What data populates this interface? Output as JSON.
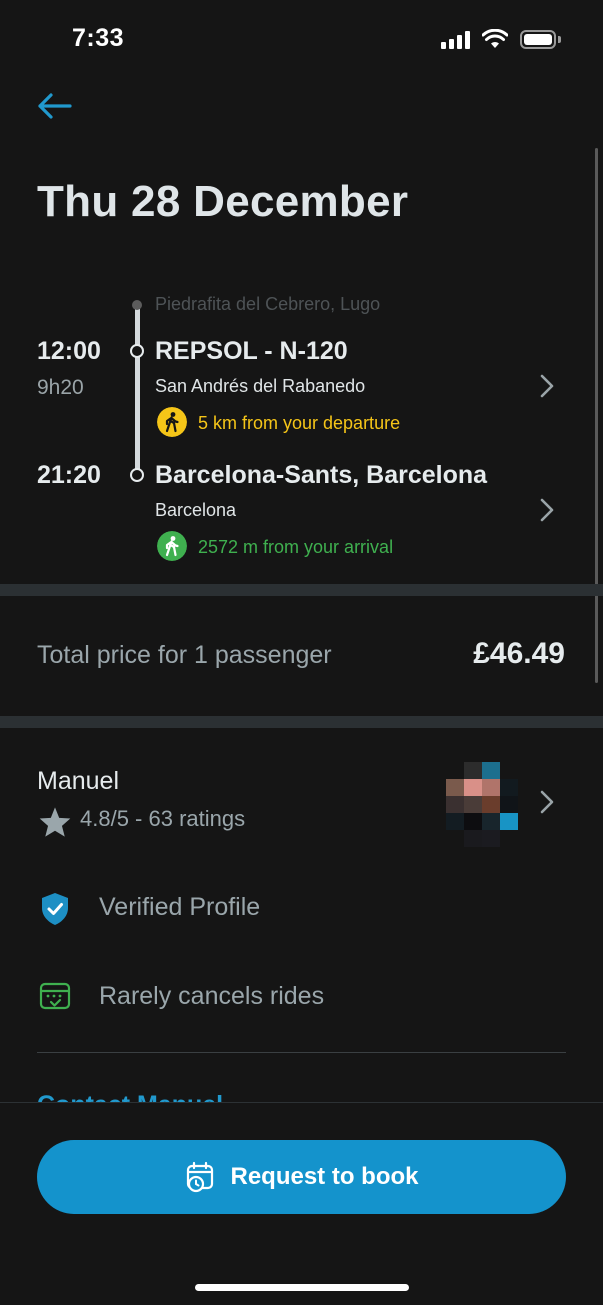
{
  "status_bar": {
    "time": "7:33"
  },
  "header": {
    "title": "Thu 28 December"
  },
  "trip": {
    "origin_label": "Piedrafita del Cebrero, Lugo",
    "departure": {
      "time": "12:00",
      "duration": "9h20",
      "name": "REPSOL - N-120",
      "city": "San Andrés del Rabanedo",
      "walk_text": "5 km from your departure",
      "walk_color": "#f5c518"
    },
    "arrival": {
      "time": "21:20",
      "name": "Barcelona-Sants, Barcelona",
      "city": "Barcelona",
      "walk_text": "2572 m from your arrival",
      "walk_color": "#3fb04f"
    }
  },
  "price": {
    "label": "Total price for 1 passenger",
    "value": "£46.49"
  },
  "driver": {
    "name": "Manuel",
    "rating": "4.8/5 - 63 ratings",
    "features": [
      {
        "icon": "verified-shield-icon",
        "label": "Verified Profile"
      },
      {
        "icon": "calendar-check-icon",
        "label": "Rarely cancels rides"
      }
    ]
  },
  "footer": {
    "clipped_link": "Contact Manuel",
    "book_label": "Request to book"
  },
  "colors": {
    "accent": "#1493cc",
    "background": "#151515",
    "departure_walk": "#f5c518",
    "arrival_walk": "#3fb04f"
  }
}
